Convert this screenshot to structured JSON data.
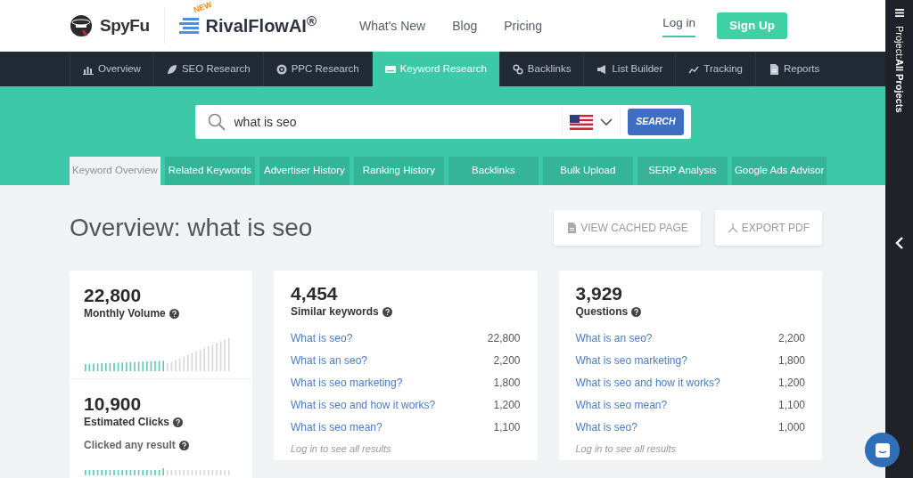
{
  "header": {
    "logo": "SpyFu",
    "partner_badge": "NEW",
    "partner_logo": "RivalFlowAI$^{®}$",
    "links": [
      {
        "label": "What's New"
      },
      {
        "label": "Blog"
      },
      {
        "label": "Pricing"
      }
    ],
    "login": "Log in",
    "signup": "Sign Up"
  },
  "main_nav": [
    {
      "label": "Overview",
      "selected": false
    },
    {
      "label": "SEO Research",
      "selected": false
    },
    {
      "label": "PPC Research",
      "selected": false
    },
    {
      "label": "Keyword Research",
      "selected": true
    },
    {
      "label": "Backlinks",
      "selected": false
    },
    {
      "label": "List Builder",
      "selected": false
    },
    {
      "label": "Tracking",
      "selected": false
    },
    {
      "label": "Reports",
      "selected": false
    }
  ],
  "search": {
    "value": "what is seo",
    "button": "SEARCH"
  },
  "sub_tabs": [
    {
      "label": "Keyword Overview",
      "selected": true
    },
    {
      "label": "Related Keywords",
      "selected": false
    },
    {
      "label": "Advertiser History",
      "selected": false
    },
    {
      "label": "Ranking History",
      "selected": false
    },
    {
      "label": "Backlinks",
      "selected": false
    },
    {
      "label": "Bulk Upload",
      "selected": false
    },
    {
      "label": "SERP Analysis",
      "selected": false
    },
    {
      "label": "Google Ads Advisor",
      "selected": false
    }
  ],
  "page_title": "Overview: what is seo",
  "actions": [
    {
      "label": "VIEW CACHED PAGE"
    },
    {
      "label": "EXPORT PDF"
    }
  ],
  "volume": {
    "value": "22,800",
    "label": "Monthly Volume"
  },
  "clicks": {
    "value": "10,900",
    "label": "Estimated Clicks",
    "sub_label": "Clicked any result"
  },
  "lists": [
    {
      "value": "4,454",
      "label": "Similar keywords",
      "rows": [
        {
          "keyword": "What is seo?",
          "volume": "22,800"
        },
        {
          "keyword": "What is an seo?",
          "volume": "2,200"
        },
        {
          "keyword": "What is seo marketing?",
          "volume": "1,800"
        },
        {
          "keyword": "What is seo and how it works?",
          "volume": "1,200"
        },
        {
          "keyword": "What is seo mean?",
          "volume": "1,100"
        }
      ],
      "footer": "Log in to see all results"
    },
    {
      "value": "3,929",
      "label": "Questions",
      "rows": [
        {
          "keyword": "What is an seo?",
          "volume": "2,200"
        },
        {
          "keyword": "What is seo marketing?",
          "volume": "1,800"
        },
        {
          "keyword": "What is seo and how it works?",
          "volume": "1,200"
        },
        {
          "keyword": "What is seo mean?",
          "volume": "1,100"
        },
        {
          "keyword": "What is seo?",
          "volume": "1,000"
        }
      ],
      "footer": "Log in to see all results"
    }
  ],
  "sidebar": {
    "label": "Project:",
    "project": "All Projects"
  }
}
